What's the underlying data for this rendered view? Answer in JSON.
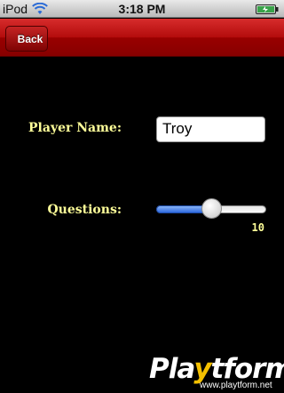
{
  "status_bar": {
    "carrier": "iPod",
    "time": "3:18 PM",
    "icons": [
      "wifi-icon",
      "battery-icon"
    ]
  },
  "nav_bar": {
    "back_label": "Back",
    "accent_color": "#b30c0c"
  },
  "form": {
    "player_label": "Player Name:",
    "player_value": "Troy",
    "questions_label": "Questions:",
    "questions_value": "10",
    "questions_level": 0.5,
    "label_color": "#ffff99"
  },
  "watermark": {
    "brand_prefix": "Pla",
    "brand_accent": "y",
    "brand_suffix": "tform",
    "url": "www.playtform.net"
  }
}
